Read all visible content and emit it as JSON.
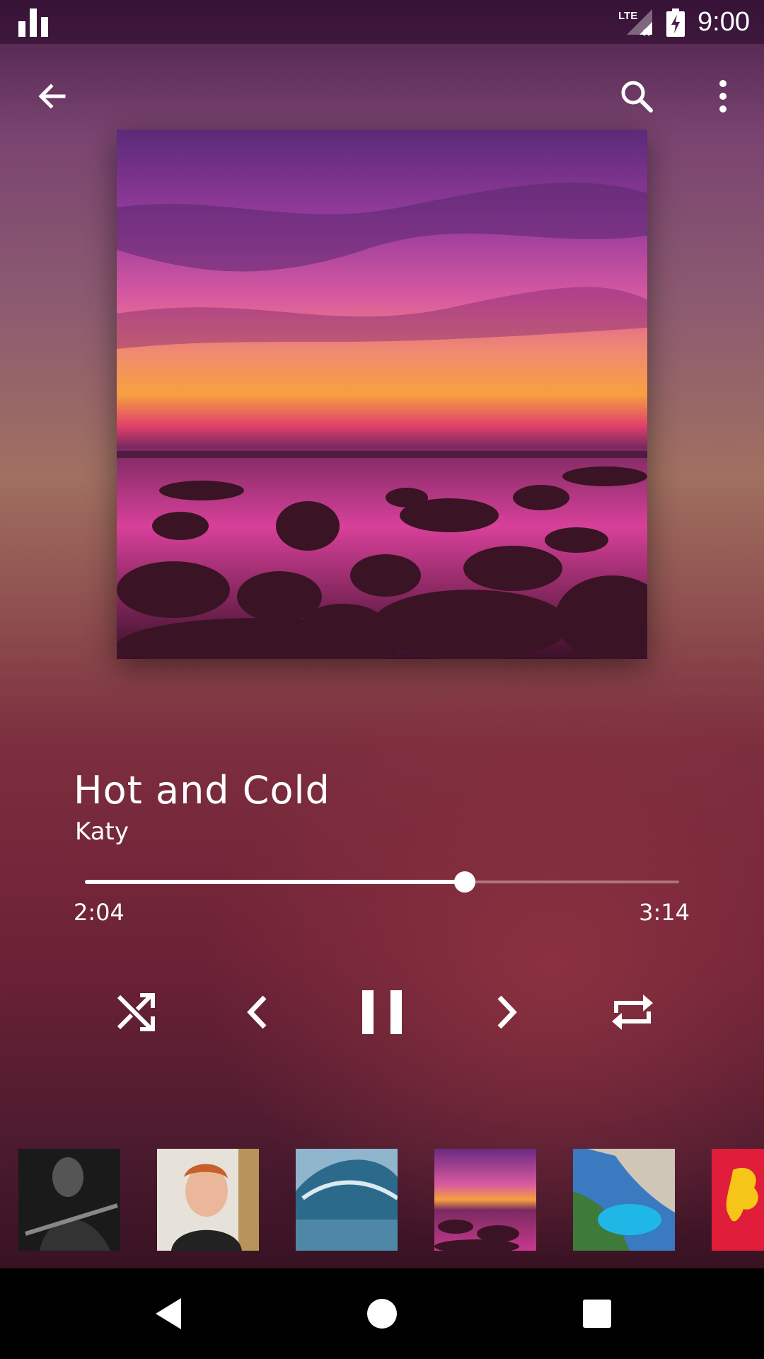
{
  "status_bar": {
    "time": "9:00",
    "network": "LTE",
    "icons": [
      "signal-bars-icon",
      "lte-no-signal-icon",
      "battery-charging-icon"
    ]
  },
  "toolbar": {
    "icons": [
      "back-arrow-icon",
      "search-icon",
      "more-vert-icon"
    ]
  },
  "now_playing": {
    "title": "Hot and Cold",
    "artist": "Katy",
    "elapsed": "2:04",
    "duration": "3:14",
    "progress_fraction": 0.639
  },
  "controls": {
    "icons": [
      "shuffle-icon",
      "previous-icon",
      "pause-icon",
      "next-icon",
      "repeat-icon"
    ]
  },
  "queue": {
    "thumbnails": [
      "guitarist-bw-thumbnail",
      "ed-sheeran-thumbnail",
      "ocean-wave-thumbnail",
      "sunset-sea-thumbnail",
      "beach-cove-thumbnail",
      "red-lion-crest-thumbnail"
    ]
  },
  "nav_bar": {
    "icons": [
      "nav-back-icon",
      "nav-home-icon",
      "nav-recents-icon"
    ]
  },
  "colors": {
    "accent": "#ffffff",
    "nav_background": "#000000"
  }
}
